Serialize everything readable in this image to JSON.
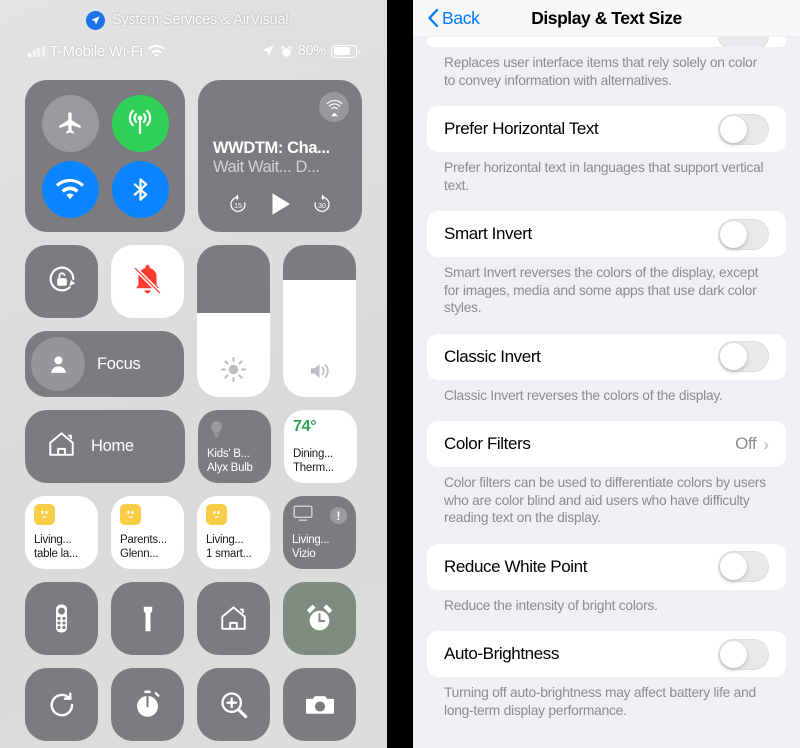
{
  "control_center": {
    "notice": {
      "icon": "location-arrow-icon",
      "text": "System Services & AirVisual",
      "chevron": "›"
    },
    "status_bar": {
      "signal_icon": "cellular-bars-icon",
      "carrier": "T-Mobile Wi-Fi",
      "wifi_icon": "wifi-icon",
      "location_icon": "location-arrow-icon",
      "alarm_icon": "alarm-clock-icon",
      "battery_percent": "80%",
      "battery_icon": "battery-icon"
    },
    "connectivity": {
      "airplane": {
        "name": "airplane-mode-toggle",
        "icon": "airplane-icon",
        "state": "off",
        "color": "#99999e"
      },
      "cellular": {
        "name": "cellular-data-toggle",
        "icon": "cellular-antenna-icon",
        "state": "on",
        "color": "#30d158"
      },
      "wifi": {
        "name": "wifi-toggle",
        "icon": "wifi-icon",
        "state": "on",
        "color": "#0a84ff"
      },
      "bluetooth": {
        "name": "bluetooth-toggle",
        "icon": "bluetooth-icon",
        "state": "on",
        "color": "#0a84ff"
      }
    },
    "media": {
      "airplay_icon": "airplay-audio-icon",
      "title": "WWDTM: Cha...",
      "subtitle": "Wait Wait... D...",
      "rewind_label": "15",
      "play_icon": "play-icon",
      "forward_label": "30"
    },
    "rotation_lock": {
      "label": "rotation-lock",
      "icon": "rotation-lock-icon",
      "state": "off"
    },
    "silent_mode": {
      "label": "silent-mode",
      "icon": "bell-slash-icon",
      "state": "on",
      "color": "#ff3b30"
    },
    "focus": {
      "label": "Focus",
      "icon": "person-icon"
    },
    "brightness": {
      "icon": "brightness-icon",
      "level_percent": 55
    },
    "volume": {
      "icon": "speaker-waves-icon",
      "level_percent": 77
    },
    "home": {
      "label": "Home",
      "icon": "home-icon"
    },
    "accessories": [
      {
        "name": "Kids' B...",
        "detail": "Alyx Bulb",
        "icon": "lightbulb-icon",
        "style": "dark"
      },
      {
        "name": "Dining...",
        "detail": "Therm...",
        "temp": "74°",
        "icon": "thermostat-icon",
        "style": "white"
      }
    ],
    "accessory_row2": [
      {
        "name": "Living...",
        "detail": "table la...",
        "icon": "outlet-icon",
        "style": "white"
      },
      {
        "name": "Parents...",
        "detail": "Glenn...",
        "icon": "outlet-icon",
        "style": "white"
      },
      {
        "name": "Living...",
        "detail": "1 smart...",
        "icon": "outlet-icon",
        "style": "white"
      },
      {
        "name": "Living...",
        "detail": "Vizio",
        "icon": "tv-icon",
        "style": "dark",
        "badge": "!"
      }
    ],
    "apps_row1": [
      {
        "icon": "apple-tv-remote-icon",
        "tone": "grey"
      },
      {
        "icon": "flashlight-icon",
        "tone": "grey"
      },
      {
        "icon": "home-icon",
        "tone": "grey"
      },
      {
        "icon": "alarm-clock-icon",
        "tone": "green"
      }
    ],
    "apps_row2": [
      {
        "icon": "screen-mirroring-icon",
        "tone": "grey"
      },
      {
        "icon": "timer-icon",
        "tone": "grey"
      },
      {
        "icon": "magnifier-icon",
        "tone": "grey"
      },
      {
        "icon": "camera-icon",
        "tone": "grey"
      }
    ]
  },
  "settings": {
    "nav": {
      "back_label": "Back",
      "back_icon": "chevron-left-icon",
      "title": "Display & Text Size"
    },
    "partial_top": {
      "toggle_state": "off"
    },
    "top_footnote": "Replaces user interface items that rely solely on color to convey information with alternatives.",
    "rows": [
      {
        "label": "Prefer Horizontal Text",
        "type": "toggle",
        "state": "off",
        "footnote": "Prefer horizontal text in languages that support vertical text."
      },
      {
        "label": "Smart Invert",
        "type": "toggle",
        "state": "off",
        "footnote": "Smart Invert reverses the colors of the display, except for images, media and some apps that use dark color styles."
      },
      {
        "label": "Classic Invert",
        "type": "toggle",
        "state": "off",
        "footnote": "Classic Invert reverses the colors of the display."
      },
      {
        "label": "Color Filters",
        "type": "link",
        "value": "Off",
        "chevron": "›",
        "footnote": "Color filters can be used to differentiate colors by users who are color blind and aid users who have difficulty reading text on the display."
      },
      {
        "label": "Reduce White Point",
        "type": "toggle",
        "state": "off",
        "footnote": "Reduce the intensity of bright colors."
      },
      {
        "label": "Auto-Brightness",
        "type": "toggle",
        "state": "off",
        "footnote": "Turning off auto-brightness may affect battery life and long-term display performance."
      }
    ]
  },
  "colors": {
    "accent_blue": "#007aff",
    "green": "#30d158",
    "red": "#ff3b30",
    "tile_grey": "#7b7b80",
    "settings_bg": "#efeff6",
    "temp_green": "#30a14e",
    "outlet_yellow": "#f7cc46"
  }
}
